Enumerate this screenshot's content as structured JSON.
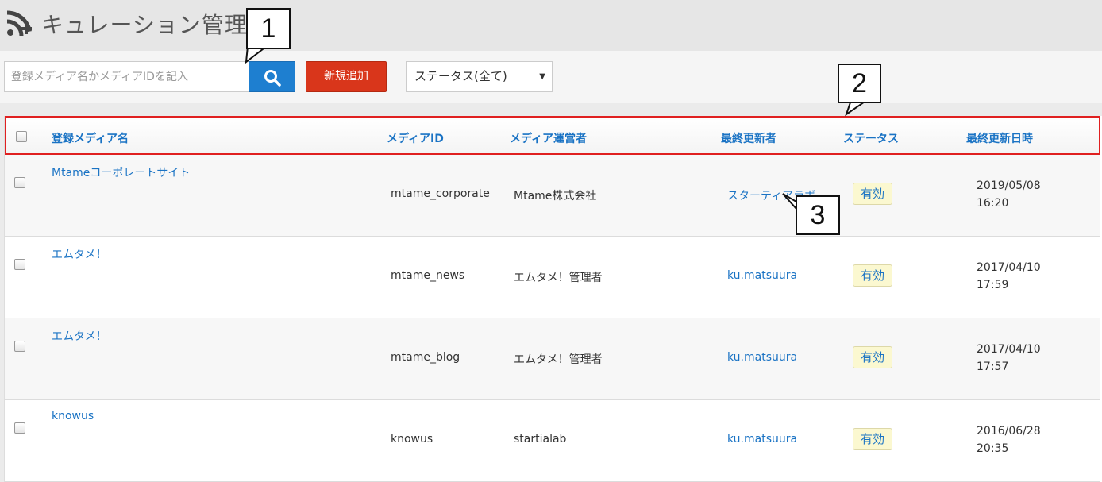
{
  "header": {
    "title": "キュレーション管理",
    "icon": "rss-plus-icon"
  },
  "toolbar": {
    "search_placeholder": "登録メディア名かメディアIDを記入",
    "search_icon": "search-icon",
    "add_label": "新規追加",
    "status_value": "ステータス(全て)"
  },
  "table": {
    "columns": [
      "登録メディア名",
      "メディアID",
      "メディア運営者",
      "最終更新者",
      "ステータス",
      "最終更新日時"
    ],
    "rows": [
      {
        "name": "Mtameコーポレートサイト",
        "media_id": "mtame_corporate",
        "operator": "Mtame株式会社",
        "updater": "スターティアラボ",
        "status": "有効",
        "date": "2019/05/08",
        "time": "16:20"
      },
      {
        "name": "エムタメ！",
        "media_id": "mtame_news",
        "operator": "エムタメ！管理者",
        "updater": "ku.matsuura",
        "status": "有効",
        "date": "2017/04/10",
        "time": "17:59"
      },
      {
        "name": "エムタメ！",
        "media_id": "mtame_blog",
        "operator": "エムタメ！管理者",
        "updater": "ku.matsuura",
        "status": "有効",
        "date": "2017/04/10",
        "time": "17:57"
      },
      {
        "name": "knowus",
        "media_id": "knowus",
        "operator": "startialab",
        "updater": "ku.matsuura",
        "status": "有効",
        "date": "2016/06/28",
        "time": "20:35"
      }
    ]
  },
  "callouts": [
    "1",
    "2",
    "3"
  ],
  "colors": {
    "accent_blue": "#1a73c4",
    "search_button": "#1e7fd0",
    "add_button": "#d9361b",
    "highlight_border": "#e02020",
    "badge_bg": "#fbf8d0"
  }
}
